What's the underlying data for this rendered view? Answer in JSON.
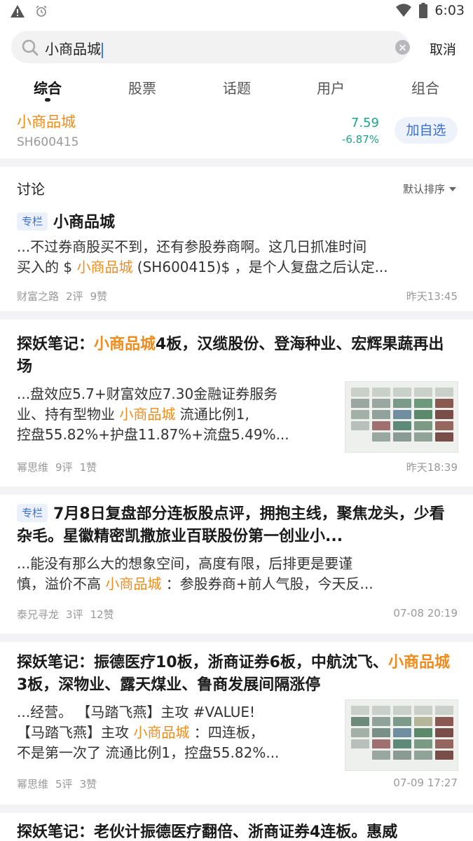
{
  "status_bar": {
    "time": "6:03"
  },
  "search": {
    "query": "小商品城",
    "cancel_label": "取消"
  },
  "tabs": [
    {
      "label": "综合",
      "active": true
    },
    {
      "label": "股票",
      "active": false
    },
    {
      "label": "话题",
      "active": false
    },
    {
      "label": "用户",
      "active": false
    },
    {
      "label": "组合",
      "active": false
    }
  ],
  "stock": {
    "name": "小商品城",
    "code": "SH600415",
    "price": "7.59",
    "change": "-6.87%",
    "add_label": "加自选"
  },
  "discussion": {
    "title": "讨论",
    "sort_label": "默认排序"
  },
  "posts": [
    {
      "badge": "专栏",
      "title": "小商品城",
      "body": [
        {
          "pre": "...不过券商股买不到，还有参股券商啊。这几日抓准时间",
          "hl": "",
          "post": ""
        },
        {
          "pre": "买入的 $ ",
          "hl": "小商品城",
          "post": " (SH600415)$ ，是个人复盘之后认定..."
        }
      ],
      "author": "财富之路",
      "comments": "2评",
      "likes": "9赞",
      "time": "昨天13:45"
    },
    {
      "title_pre": "探妖笔记：",
      "title_hl": "小商品城",
      "title_post": "4板，汉缆股份、登海种业、宏辉果蔬再出场",
      "body": [
        {
          "pre": "...盘效应5.7+财富效应7.30金融证券服务",
          "hl": "",
          "post": ""
        },
        {
          "pre": "业、持有型物业 ",
          "hl": "小商品城",
          "post": " 流通比例1,"
        },
        {
          "pre": "控盘55.82%+护盘11.87%+流盘5.49%...",
          "hl": "",
          "post": ""
        }
      ],
      "author": "幂思维",
      "comments": "9评",
      "likes": "1赞",
      "time": "昨天18:39"
    },
    {
      "badge": "专栏",
      "title": "7月8日复盘部分连板股点评，拥抱主线，聚焦龙头，少看杂毛。星徽精密凯撒旅业百联股份第一创业小...",
      "body": [
        {
          "pre": "...能没有那么大的想象空间，高度有限，后排更是要谨",
          "hl": "",
          "post": ""
        },
        {
          "pre": "慎，溢价不高 ",
          "hl": "小商品城",
          "post": " ：参股券商+前人气股，今天反..."
        }
      ],
      "author": "泰兄寻龙",
      "comments": "3评",
      "likes": "12赞",
      "time": "07-08 20:19"
    },
    {
      "title_pre": "探妖笔记：振德医疗10板，浙商证券6板，中航沈飞、",
      "title_hl": "小商品城",
      "title_post": "3板，深物业、露天煤业、鲁商发展间隔涨停",
      "body": [
        {
          "pre": "...经营。 【马踏飞燕】主攻 #VALUE!",
          "hl": "",
          "post": ""
        },
        {
          "pre": "【马踏飞燕】主攻 ",
          "hl": "小商品城",
          "post": " ：四连板，"
        },
        {
          "pre": "不是第一次了 流通比例1，控盘55.82%...",
          "hl": "",
          "post": ""
        }
      ],
      "author": "幂思维",
      "comments": "5评",
      "likes": "3赞",
      "time": "07-09 17:27"
    },
    {
      "title": "探妖笔记：老伙计振德医疗翻倍、浙商证券4连板。惠威"
    }
  ],
  "colors": {
    "highlight": "#f08c1c",
    "price_down": "#1ea58a",
    "accent": "#3a6fd8"
  }
}
